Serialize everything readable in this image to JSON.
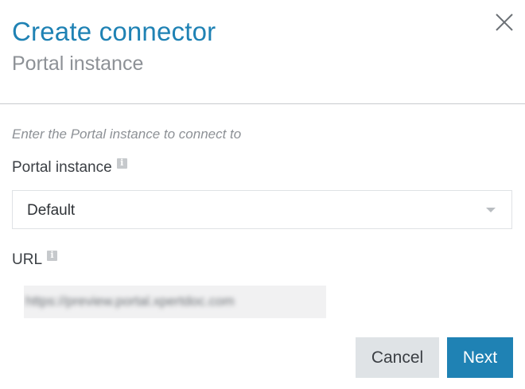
{
  "dialog": {
    "title": "Create connector",
    "subtitle": "Portal instance",
    "close_icon": "close-icon"
  },
  "form": {
    "hint": "Enter the Portal instance to connect to",
    "portal_instance": {
      "label": "Portal instance",
      "info_icon": "info-icon",
      "selected_value": "Default"
    },
    "url": {
      "label": "URL",
      "info_icon": "info-icon",
      "value": "https://preview.portal.xpertdoc.com"
    }
  },
  "footer": {
    "cancel_label": "Cancel",
    "next_label": "Next"
  },
  "colors": {
    "accent": "#1f82b4",
    "secondary_button": "#dfe3e6",
    "muted_text": "#8d9196"
  }
}
